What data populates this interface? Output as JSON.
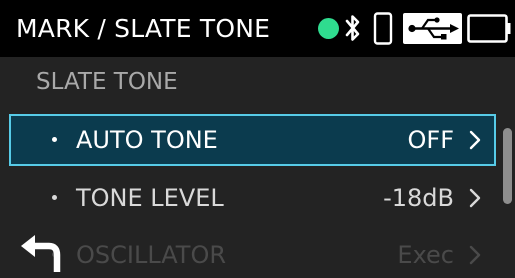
{
  "header": {
    "title": "MARK / SLATE TONE",
    "status_dot_color": "#2fdc8f",
    "icons": [
      "status-dot",
      "bluetooth-icon",
      "phone-icon",
      "usb-icon",
      "battery-icon"
    ]
  },
  "section": {
    "title": "SLATE TONE"
  },
  "menu": {
    "items": [
      {
        "label": "AUTO TONE",
        "value": "OFF",
        "state": "selected"
      },
      {
        "label": "TONE LEVEL",
        "value": "-18dB",
        "state": "normal"
      },
      {
        "label": "OSCILLATOR",
        "value": "Exec",
        "state": "dimmed"
      }
    ]
  },
  "colors": {
    "background": "#232323",
    "header_bg": "#000000",
    "selection_fill": "#0b3b4e",
    "selection_border": "#57cbe7",
    "section_text": "#a9a9a9"
  },
  "scrollbar": {
    "visible": true
  }
}
